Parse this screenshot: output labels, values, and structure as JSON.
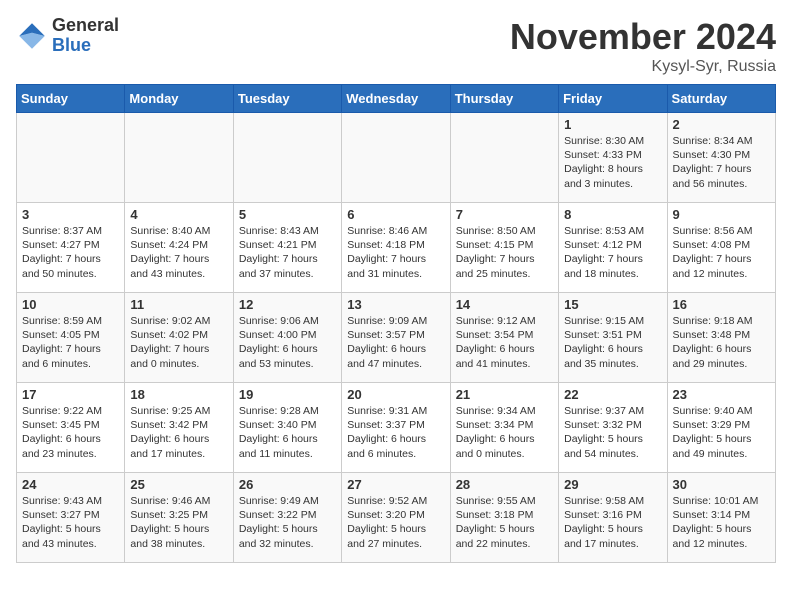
{
  "header": {
    "logo_general": "General",
    "logo_blue": "Blue",
    "month_title": "November 2024",
    "location": "Kysyl-Syr, Russia"
  },
  "days_of_week": [
    "Sunday",
    "Monday",
    "Tuesday",
    "Wednesday",
    "Thursday",
    "Friday",
    "Saturday"
  ],
  "weeks": [
    [
      {
        "day": "",
        "text": ""
      },
      {
        "day": "",
        "text": ""
      },
      {
        "day": "",
        "text": ""
      },
      {
        "day": "",
        "text": ""
      },
      {
        "day": "",
        "text": ""
      },
      {
        "day": "1",
        "text": "Sunrise: 8:30 AM\nSunset: 4:33 PM\nDaylight: 8 hours and 3 minutes."
      },
      {
        "day": "2",
        "text": "Sunrise: 8:34 AM\nSunset: 4:30 PM\nDaylight: 7 hours and 56 minutes."
      }
    ],
    [
      {
        "day": "3",
        "text": "Sunrise: 8:37 AM\nSunset: 4:27 PM\nDaylight: 7 hours and 50 minutes."
      },
      {
        "day": "4",
        "text": "Sunrise: 8:40 AM\nSunset: 4:24 PM\nDaylight: 7 hours and 43 minutes."
      },
      {
        "day": "5",
        "text": "Sunrise: 8:43 AM\nSunset: 4:21 PM\nDaylight: 7 hours and 37 minutes."
      },
      {
        "day": "6",
        "text": "Sunrise: 8:46 AM\nSunset: 4:18 PM\nDaylight: 7 hours and 31 minutes."
      },
      {
        "day": "7",
        "text": "Sunrise: 8:50 AM\nSunset: 4:15 PM\nDaylight: 7 hours and 25 minutes."
      },
      {
        "day": "8",
        "text": "Sunrise: 8:53 AM\nSunset: 4:12 PM\nDaylight: 7 hours and 18 minutes."
      },
      {
        "day": "9",
        "text": "Sunrise: 8:56 AM\nSunset: 4:08 PM\nDaylight: 7 hours and 12 minutes."
      }
    ],
    [
      {
        "day": "10",
        "text": "Sunrise: 8:59 AM\nSunset: 4:05 PM\nDaylight: 7 hours and 6 minutes."
      },
      {
        "day": "11",
        "text": "Sunrise: 9:02 AM\nSunset: 4:02 PM\nDaylight: 7 hours and 0 minutes."
      },
      {
        "day": "12",
        "text": "Sunrise: 9:06 AM\nSunset: 4:00 PM\nDaylight: 6 hours and 53 minutes."
      },
      {
        "day": "13",
        "text": "Sunrise: 9:09 AM\nSunset: 3:57 PM\nDaylight: 6 hours and 47 minutes."
      },
      {
        "day": "14",
        "text": "Sunrise: 9:12 AM\nSunset: 3:54 PM\nDaylight: 6 hours and 41 minutes."
      },
      {
        "day": "15",
        "text": "Sunrise: 9:15 AM\nSunset: 3:51 PM\nDaylight: 6 hours and 35 minutes."
      },
      {
        "day": "16",
        "text": "Sunrise: 9:18 AM\nSunset: 3:48 PM\nDaylight: 6 hours and 29 minutes."
      }
    ],
    [
      {
        "day": "17",
        "text": "Sunrise: 9:22 AM\nSunset: 3:45 PM\nDaylight: 6 hours and 23 minutes."
      },
      {
        "day": "18",
        "text": "Sunrise: 9:25 AM\nSunset: 3:42 PM\nDaylight: 6 hours and 17 minutes."
      },
      {
        "day": "19",
        "text": "Sunrise: 9:28 AM\nSunset: 3:40 PM\nDaylight: 6 hours and 11 minutes."
      },
      {
        "day": "20",
        "text": "Sunrise: 9:31 AM\nSunset: 3:37 PM\nDaylight: 6 hours and 6 minutes."
      },
      {
        "day": "21",
        "text": "Sunrise: 9:34 AM\nSunset: 3:34 PM\nDaylight: 6 hours and 0 minutes."
      },
      {
        "day": "22",
        "text": "Sunrise: 9:37 AM\nSunset: 3:32 PM\nDaylight: 5 hours and 54 minutes."
      },
      {
        "day": "23",
        "text": "Sunrise: 9:40 AM\nSunset: 3:29 PM\nDaylight: 5 hours and 49 minutes."
      }
    ],
    [
      {
        "day": "24",
        "text": "Sunrise: 9:43 AM\nSunset: 3:27 PM\nDaylight: 5 hours and 43 minutes."
      },
      {
        "day": "25",
        "text": "Sunrise: 9:46 AM\nSunset: 3:25 PM\nDaylight: 5 hours and 38 minutes."
      },
      {
        "day": "26",
        "text": "Sunrise: 9:49 AM\nSunset: 3:22 PM\nDaylight: 5 hours and 32 minutes."
      },
      {
        "day": "27",
        "text": "Sunrise: 9:52 AM\nSunset: 3:20 PM\nDaylight: 5 hours and 27 minutes."
      },
      {
        "day": "28",
        "text": "Sunrise: 9:55 AM\nSunset: 3:18 PM\nDaylight: 5 hours and 22 minutes."
      },
      {
        "day": "29",
        "text": "Sunrise: 9:58 AM\nSunset: 3:16 PM\nDaylight: 5 hours and 17 minutes."
      },
      {
        "day": "30",
        "text": "Sunrise: 10:01 AM\nSunset: 3:14 PM\nDaylight: 5 hours and 12 minutes."
      }
    ]
  ]
}
